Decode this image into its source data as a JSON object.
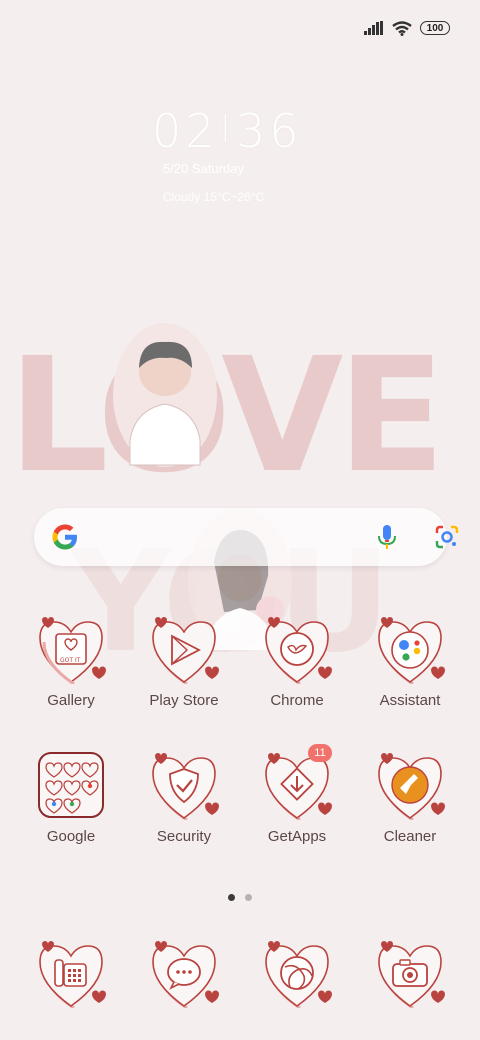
{
  "status_bar": {
    "battery_level": "100"
  },
  "clock": {
    "hour": "02",
    "minute": "36",
    "date": "5/20 Saturday",
    "weather": "Cloudy 15°C~26°C"
  },
  "wallpaper": {
    "text_top": "LOVE",
    "text_bottom": "YOU"
  },
  "apps_row1": [
    {
      "label": "Gallery"
    },
    {
      "label": "Play Store"
    },
    {
      "label": "Chrome"
    },
    {
      "label": "Assistant"
    }
  ],
  "apps_row2": [
    {
      "label": "Google"
    },
    {
      "label": "Security"
    },
    {
      "label": "GetApps",
      "badge": "11"
    },
    {
      "label": "Cleaner"
    }
  ],
  "page_indicator": {
    "pages": 2,
    "current": 1
  },
  "colors": {
    "heart": "#b8433f",
    "outline": "#e9a9a6",
    "background": "#f5eeee"
  }
}
